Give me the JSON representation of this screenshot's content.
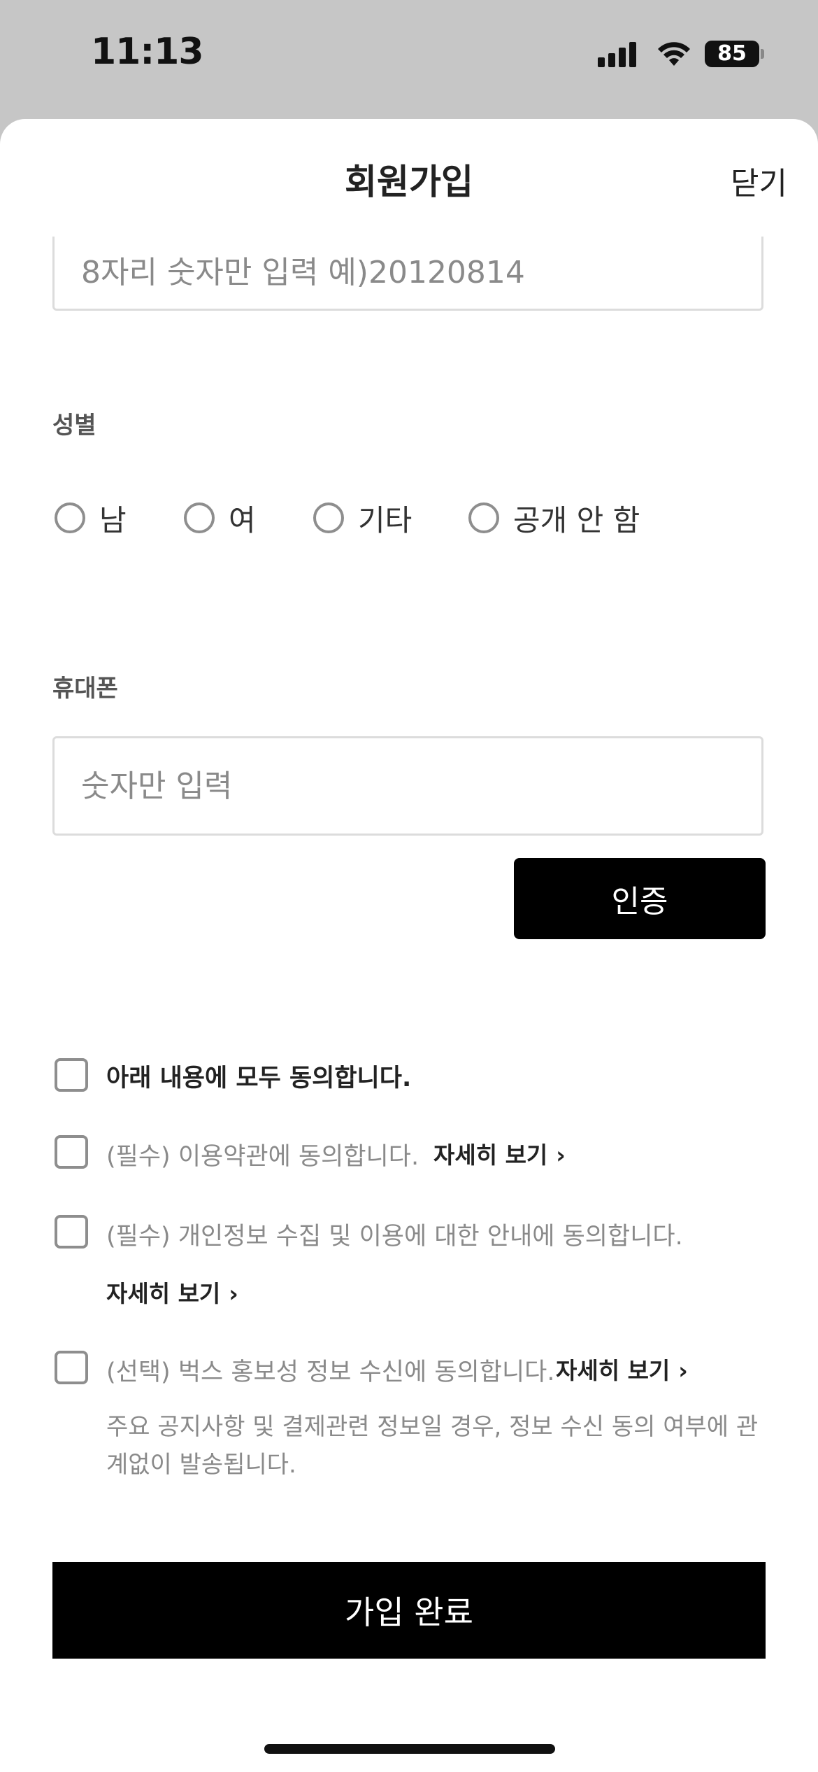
{
  "status_bar": {
    "time": "11:13",
    "battery": "85"
  },
  "header": {
    "title": "회원가입",
    "close_label": "닫기"
  },
  "birth": {
    "placeholder": "8자리 숫자만 입력 예)20120814"
  },
  "gender": {
    "label": "성별",
    "options": [
      "남",
      "여",
      "기타",
      "공개 안 함"
    ]
  },
  "phone": {
    "label": "휴대폰",
    "placeholder": "숫자만 입력",
    "verify_label": "인증"
  },
  "agreements": {
    "all": "아래 내용에 모두 동의합니다.",
    "terms": "(필수) 이용약관에 동의합니다.",
    "privacy": "(필수) 개인정보 수집 및 이용에 대한 안내에 동의합니다.",
    "marketing": "(선택) 벅스 홍보성 정보 수신에 동의합니다.",
    "detail_label": "자세히 보기",
    "notice": "주요 공지사항 및 결제관련 정보일 경우, 정보 수신 동의 여부에 관계없이 발송됩니다."
  },
  "submit_label": "가입 완료"
}
